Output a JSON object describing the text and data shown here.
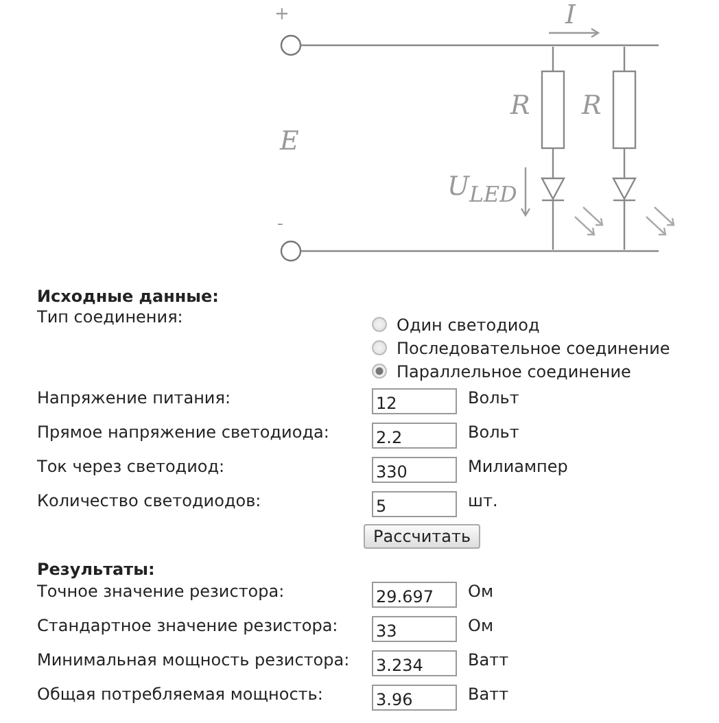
{
  "diagram": {
    "plus": "+",
    "minus": "-",
    "current": "I",
    "resistors": [
      "R",
      "R"
    ],
    "source": "E",
    "led_voltage": "U$_{LED}$"
  },
  "inputs": {
    "title": "Исходные данные:",
    "connection_type": {
      "label": "Тип соединения:",
      "options": [
        {
          "label": "Один светодиод",
          "selected": false
        },
        {
          "label": "Последовательное соединение",
          "selected": false
        },
        {
          "label": "Параллельное соединение",
          "selected": true
        }
      ]
    },
    "fields": [
      {
        "label": "Напряжение питания:",
        "value": "12",
        "unit": "Вольт"
      },
      {
        "label": "Прямое напряжение светодиода:",
        "value": "2.2",
        "unit": "Вольт"
      },
      {
        "label": "Ток через светодиод:",
        "value": "330",
        "unit": "Милиампер"
      },
      {
        "label": "Количество светодиодов:",
        "value": "5",
        "unit": "шт."
      }
    ]
  },
  "button": "Рассчитать",
  "results": {
    "title": "Результаты:",
    "fields": [
      {
        "label": "Точное значение резистора:",
        "value": "29.697",
        "unit": "Ом"
      },
      {
        "label": "Стандартное значение резистора:",
        "value": "33",
        "unit": "Ом"
      },
      {
        "label": "Минимальная мощность резистора:",
        "value": "3.234",
        "unit": "Ватт"
      },
      {
        "label": "Общая потребляемая мощность:",
        "value": "3.96",
        "unit": "Ватт"
      }
    ]
  }
}
